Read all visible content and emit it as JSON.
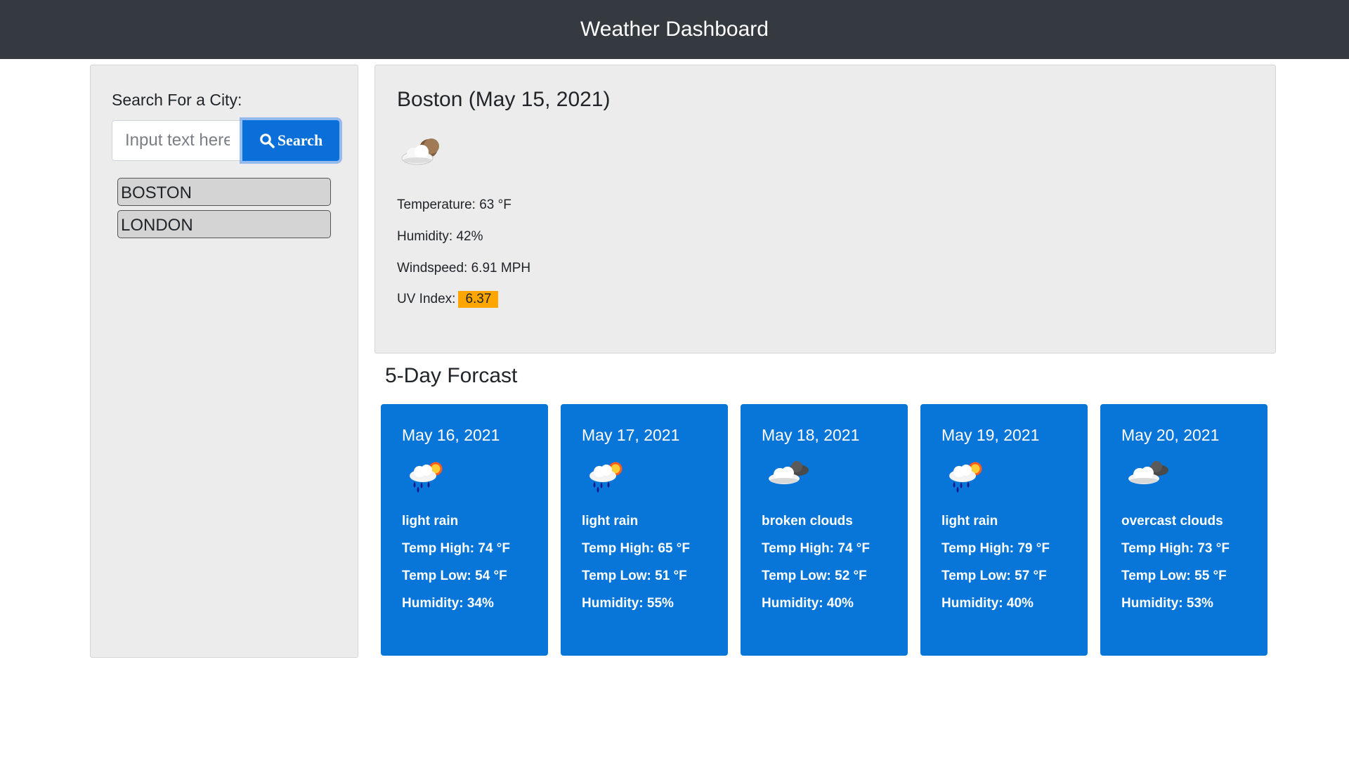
{
  "header": {
    "title": "Weather Dashboard"
  },
  "search": {
    "label": "Search For a City:",
    "placeholder": "Input text here",
    "value": "",
    "button_label": "Search",
    "icon": "search-icon",
    "history": [
      "BOSTON",
      "LONDON"
    ]
  },
  "current": {
    "heading": "Boston (May 15, 2021)",
    "icon": "few-clouds-night-icon",
    "temperature": "Temperature: 63 °F",
    "humidity": "Humidity: 42%",
    "windspeed": "Windspeed: 6.91 MPH",
    "uv_label": "UV Index:",
    "uv_value": "6.37",
    "uv_color": "#ffa500"
  },
  "forecast": {
    "title": "5-Day Forcast",
    "card_color": "#0875d9",
    "days": [
      {
        "date": "May 16, 2021",
        "icon": "rain-sun-icon",
        "description": "light rain",
        "high": "Temp High: 74 °F",
        "low": "Temp Low: 54 °F",
        "humidity": "Humidity: 34%"
      },
      {
        "date": "May 17, 2021",
        "icon": "rain-sun-icon",
        "description": "light rain",
        "high": "Temp High: 65 °F",
        "low": "Temp Low: 51 °F",
        "humidity": "Humidity: 55%"
      },
      {
        "date": "May 18, 2021",
        "icon": "broken-clouds-icon",
        "description": "broken clouds",
        "high": "Temp High: 74 °F",
        "low": "Temp Low: 52 °F",
        "humidity": "Humidity: 40%"
      },
      {
        "date": "May 19, 2021",
        "icon": "rain-sun-icon",
        "description": "light rain",
        "high": "Temp High: 79 °F",
        "low": "Temp Low: 57 °F",
        "humidity": "Humidity: 40%"
      },
      {
        "date": "May 20, 2021",
        "icon": "overcast-clouds-icon",
        "description": "overcast clouds",
        "high": "Temp High: 73 °F",
        "low": "Temp Low: 55 °F",
        "humidity": "Humidity: 53%"
      }
    ]
  }
}
